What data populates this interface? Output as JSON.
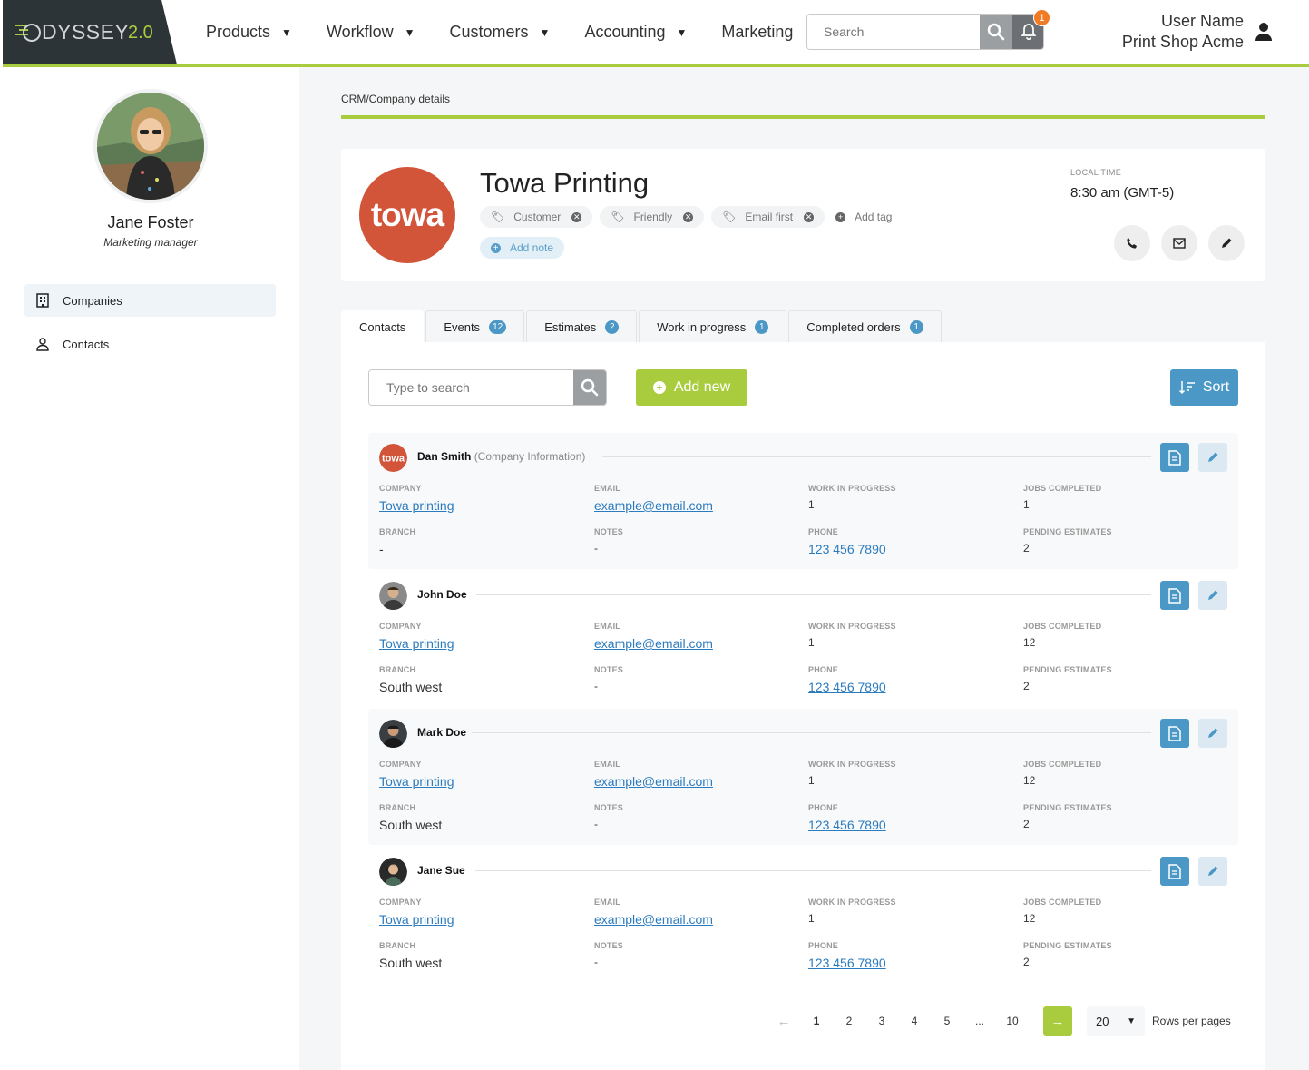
{
  "app": {
    "logo_text": "DYSSEY",
    "logo_version": "2.0",
    "nav": [
      {
        "label": "Products",
        "dropdown": true
      },
      {
        "label": "Workflow",
        "dropdown": true
      },
      {
        "label": "Customers",
        "dropdown": true
      },
      {
        "label": "Accounting",
        "dropdown": true
      },
      {
        "label": "Marketing",
        "dropdown": false
      }
    ],
    "search_placeholder": "Search",
    "notification_count": "1",
    "user_name": "User Name",
    "user_company": "Print Shop Acme",
    "accent_color": "#a9cc3e",
    "primary_color": "#4b98c7"
  },
  "sidebar": {
    "profile_name": "Jane Foster",
    "profile_role": "Marketing manager",
    "items": [
      {
        "label": "Companies",
        "icon": "building-icon",
        "active": true
      },
      {
        "label": "Contacts",
        "icon": "person-icon",
        "active": false
      }
    ]
  },
  "main": {
    "breadcrumb": "CRM/Company details",
    "company": {
      "logo_text": "towa",
      "name": "Towa Printing",
      "tags": [
        "Customer",
        "Friendly",
        "Email first"
      ],
      "add_tag_label": "Add tag",
      "add_note_label": "Add note",
      "local_time_label": "LOCAL TIME",
      "local_time": "8:30 am (GMT-5)"
    },
    "tabs": [
      {
        "label": "Contacts",
        "count": ""
      },
      {
        "label": "Events",
        "count": "12"
      },
      {
        "label": "Estimates",
        "count": "2"
      },
      {
        "label": "Work in progress",
        "count": "1"
      },
      {
        "label": "Completed orders",
        "count": "1"
      }
    ],
    "search_placeholder": "Type to search",
    "add_new_label": "Add new",
    "sort_label": "Sort",
    "field_labels": {
      "company": "COMPANY",
      "email": "EMAIL",
      "wip": "WORK IN PROGRESS",
      "jobs": "JOBS COMPLETED",
      "branch": "BRANCH",
      "notes": "NOTES",
      "phone": "PHONE",
      "pending": "PENDING ESTIMATES"
    },
    "contacts": [
      {
        "name": "Dan Smith",
        "sub": "(Company Information)",
        "company": "Towa printing",
        "email": "example@email.com",
        "wip": "1",
        "jobs": "1",
        "branch": "-",
        "notes": "-",
        "phone": "123 456 7890",
        "pending": "2"
      },
      {
        "name": "John Doe",
        "sub": "",
        "company": "Towa printing",
        "email": "example@email.com",
        "wip": "1",
        "jobs": "12",
        "branch": "South west",
        "notes": "-",
        "phone": "123 456 7890",
        "pending": "2"
      },
      {
        "name": "Mark Doe",
        "sub": "",
        "company": "Towa printing",
        "email": "example@email.com",
        "wip": "1",
        "jobs": "12",
        "branch": "South west",
        "notes": "-",
        "phone": "123 456 7890",
        "pending": "2"
      },
      {
        "name": "Jane Sue",
        "sub": "",
        "company": "Towa printing",
        "email": "example@email.com",
        "wip": "1",
        "jobs": "12",
        "branch": "South west",
        "notes": "-",
        "phone": "123 456 7890",
        "pending": "2"
      }
    ],
    "pagination": {
      "pages": [
        "1",
        "2",
        "3",
        "4",
        "5",
        "...",
        "10"
      ],
      "current": "1",
      "rows_per_page": "20",
      "rows_label": "Rows per pages"
    }
  }
}
